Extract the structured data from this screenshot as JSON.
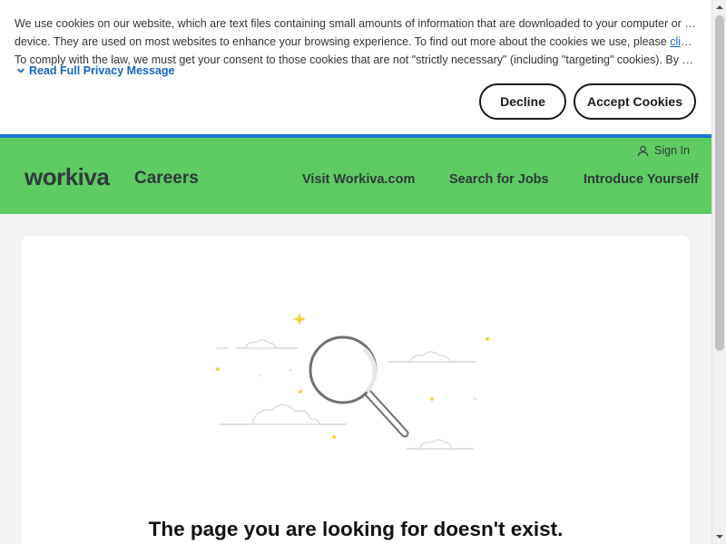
{
  "cookie_banner": {
    "line1": "We use cookies on our website, which are text files containing small amounts of information that are downloaded to your computer or mobile",
    "line2_prefix": "device. They are used on most websites to enhance your browsing experience. To find out more about the cookies we use, please ",
    "link_text": "click here",
    "line2_suffix": ".",
    "line3": "To comply with the law, we must get your consent to those cookies that are not \"strictly necessary\" (including \"targeting\" cookies). By closing",
    "read_full_label": "Read Full Privacy Message",
    "decline_label": "Decline",
    "accept_label": "Accept Cookies"
  },
  "header": {
    "logo_text": "workiva",
    "site_title": "Careers",
    "sign_in_label": "Sign In",
    "nav": {
      "visit": "Visit Workiva.com",
      "search": "Search for Jobs",
      "introduce": "Introduce Yourself"
    }
  },
  "main": {
    "message": "The page you are looking for doesn't exist."
  },
  "colors": {
    "header_bg": "#5ecb63",
    "accent_blue": "#1976d2",
    "link_blue": "#1565c0",
    "sparkle": "#f7d13c"
  },
  "icons": [
    "chevron-down-icon",
    "user-icon",
    "magnifier-illustration",
    "cloud-icon",
    "sparkle-icon"
  ]
}
